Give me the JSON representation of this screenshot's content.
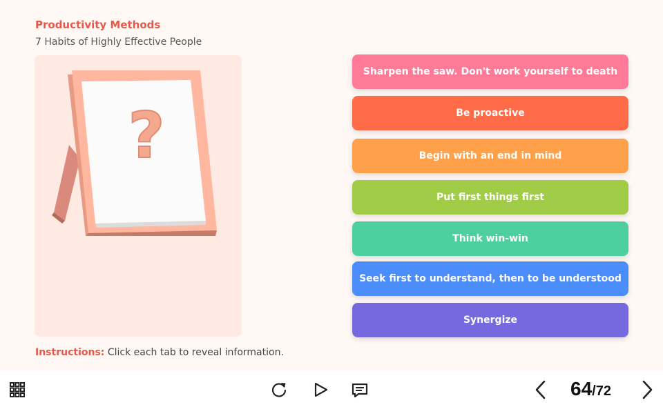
{
  "header": {
    "title": "Productivity Methods",
    "subtitle": "7 Habits of Highly Effective People"
  },
  "image": {
    "glyph": "?",
    "icon": "question-mark-frame-icon"
  },
  "tabs": [
    {
      "label": "Sharpen the saw. Don't work yourself to death",
      "color": "#ff7a96"
    },
    {
      "label": "Be proactive",
      "color": "#ff6b47"
    },
    {
      "label": "Begin with an end in mind",
      "color": "#ffa04a"
    },
    {
      "label": "Put first things first",
      "color": "#a1cc47"
    },
    {
      "label": "Think win-win",
      "color": "#4dcfa0"
    },
    {
      "label": "Seek first to understand, then to be understood",
      "color": "#4b8dfa"
    },
    {
      "label": "Synergize",
      "color": "#7669e0"
    }
  ],
  "instructions": {
    "label": "Instructions:",
    "text": " Click each tab to reveal information."
  },
  "player": {
    "current_page": "64",
    "separator": "/",
    "total_pages": "72",
    "icons": {
      "menu": "grid-menu-icon",
      "replay": "replay-icon",
      "play": "play-icon",
      "captions": "captions-icon",
      "prev": "chevron-left-icon",
      "next": "chevron-right-icon"
    }
  }
}
